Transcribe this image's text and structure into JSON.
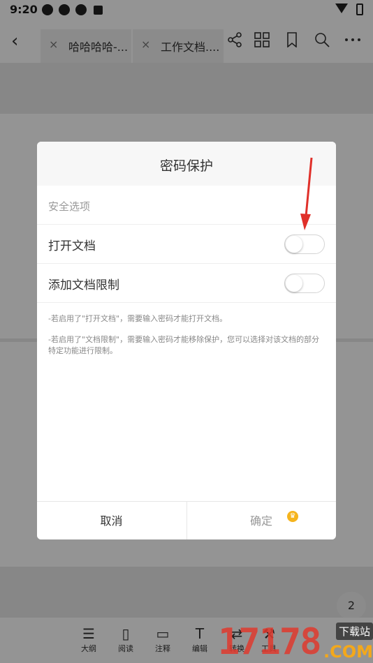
{
  "status_bar": {
    "time": "9:20",
    "notif_icons": [
      "app-icon",
      "app-icon",
      "app-icon",
      "a-icon"
    ]
  },
  "toolbar": {
    "tabs": [
      {
        "label": "哈哈哈哈-..."
      },
      {
        "label": "工作文档...."
      }
    ],
    "close_glyph": "×"
  },
  "page_number": "2",
  "bottom_bar": {
    "items": [
      {
        "label": "大纲",
        "icon": "list-icon"
      },
      {
        "label": "阅读",
        "icon": "read-icon"
      },
      {
        "label": "注释",
        "icon": "comment-icon"
      },
      {
        "label": "编辑",
        "icon": "edit-icon"
      },
      {
        "label": "转换",
        "icon": "convert-icon"
      },
      {
        "label": "工具",
        "icon": "tool-icon"
      }
    ]
  },
  "watermark": {
    "digits": "17178",
    "tag": "下载站",
    "com": ".COM"
  },
  "dialog": {
    "title": "密码保护",
    "section_label": "安全选项",
    "options": [
      {
        "label": "打开文档",
        "enabled": false
      },
      {
        "label": "添加文档限制",
        "enabled": false
      }
    ],
    "notes": [
      "-若启用了\"打开文档\"，需要输入密码才能打开文档。",
      "-若启用了\"文档限制\"，需要输入密码才能移除保护，您可以选择对该文档的部分特定功能进行限制。"
    ],
    "cancel_label": "取消",
    "confirm_label": "确定"
  },
  "colors": {
    "arrow": "#e0302a",
    "crown": "#f5b41d"
  }
}
